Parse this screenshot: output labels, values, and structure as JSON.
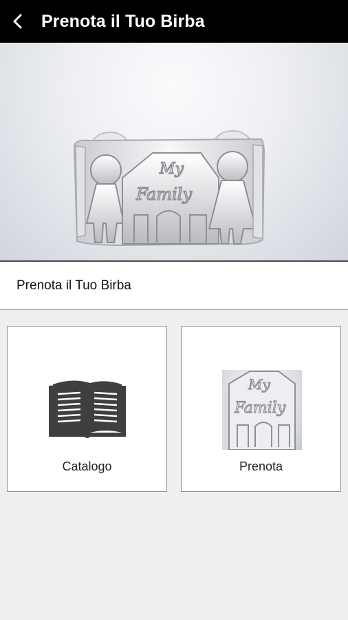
{
  "appbar": {
    "title": "Prenota il Tuo Birba",
    "back_icon": "arrow-back-icon"
  },
  "hero": {
    "alt": "silver cuff bracelet My Family",
    "engraving_top": "My",
    "engraving_bottom": "Family"
  },
  "section": {
    "title": "Prenota il Tuo Birba"
  },
  "tiles": [
    {
      "label": "Catalogo",
      "icon": "open-book-icon"
    },
    {
      "label": "Prenota",
      "icon": "bracelet-thumbnail"
    }
  ],
  "colors": {
    "appbar": "#000000",
    "background": "#efefef",
    "tile": "#ffffff",
    "border": "#8f8f8f"
  }
}
